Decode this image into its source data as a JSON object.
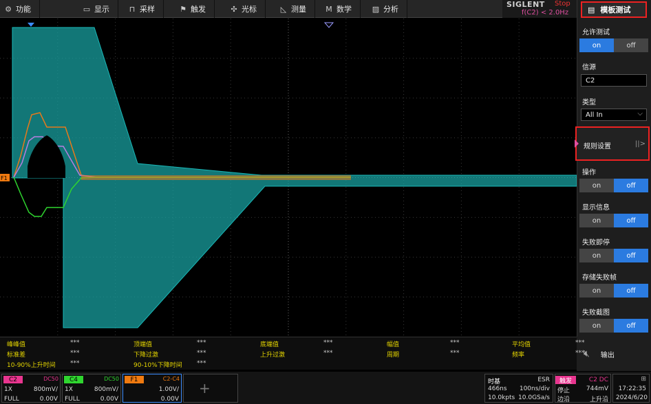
{
  "menubar": {
    "items": [
      {
        "label": "功能",
        "icon": "gear-icon"
      },
      {
        "label": "显示",
        "icon": "display-icon"
      },
      {
        "label": "采样",
        "icon": "acquire-icon"
      },
      {
        "label": "触发",
        "icon": "flag-icon"
      },
      {
        "label": "光标",
        "icon": "cursor-icon"
      },
      {
        "label": "测量",
        "icon": "measure-icon"
      },
      {
        "label": "数学",
        "icon": "math-icon"
      },
      {
        "label": "分析",
        "icon": "analysis-icon"
      }
    ]
  },
  "brand": {
    "logo": "SIGLENT",
    "status": "Stop",
    "condition": "f(C2) < 2.0Hz"
  },
  "sidebar": {
    "title": "模板测试",
    "allow_test": {
      "label": "允许测试",
      "on": "on",
      "off": "off"
    },
    "source": {
      "label": "信源",
      "value": "C2"
    },
    "type": {
      "label": "类型",
      "value": "All In"
    },
    "rules": {
      "label": "规则设置",
      "arrow": "||>"
    },
    "operation": {
      "label": "操作",
      "on": "on",
      "off": "off"
    },
    "show_info": {
      "label": "显示信息",
      "on": "on",
      "off": "off"
    },
    "stop_on_fail": {
      "label": "失败即停",
      "on": "on",
      "off": "off"
    },
    "save_fail_frame": {
      "label": "存储失败帧",
      "on": "on",
      "off": "off"
    },
    "fail_screenshot": {
      "label": "失败截图",
      "on": "on",
      "off": "off"
    },
    "output": {
      "label": "输出"
    }
  },
  "measurements": {
    "row1": [
      {
        "name": "峰峰值",
        "value": "***"
      },
      {
        "name": "顶端值",
        "value": "***"
      },
      {
        "name": "底端值",
        "value": "***"
      },
      {
        "name": "幅值",
        "value": "***"
      },
      {
        "name": "平均值",
        "value": "***"
      }
    ],
    "row2": [
      {
        "name": "标准差",
        "value": "***"
      },
      {
        "name": "下降过激",
        "value": "***"
      },
      {
        "name": "上升过激",
        "value": "***"
      },
      {
        "name": "周期",
        "value": "***"
      },
      {
        "name": "频率",
        "value": "***"
      }
    ],
    "row3": [
      {
        "name": "10-90%上升时间",
        "value": "***"
      },
      {
        "name": "90-10%下降时间",
        "value": "***"
      }
    ]
  },
  "channels": {
    "c2": {
      "tag": "C2",
      "coupling": "DC50",
      "probe": "1X",
      "scale": "800mV/",
      "bw": "FULL",
      "offset": "0.00V",
      "color": "#e8358f"
    },
    "c4": {
      "tag": "C4",
      "coupling": "DC50",
      "probe": "1X",
      "scale": "800mV/",
      "bw": "FULL",
      "offset": "0.00V",
      "color": "#2fd52f"
    },
    "f1": {
      "tag": "F1",
      "formula": "C2-C4",
      "scale": "1.00V/",
      "offset": "0.00V",
      "color": "#f07a10"
    }
  },
  "timebase": {
    "label": "时基",
    "mode": "ESR",
    "delay": "466ns",
    "scale": "100ns/div",
    "points": "10.0kpts",
    "rate": "10.0GSa/s"
  },
  "trigger": {
    "label": "触发",
    "source": "C2 DC",
    "state": "停止",
    "level": "744mV",
    "type": "边沿",
    "slope": "上升沿"
  },
  "clock": {
    "time": "17:22:35",
    "date": "2024/6/20"
  },
  "markers": {
    "f1_marker": "F1"
  }
}
